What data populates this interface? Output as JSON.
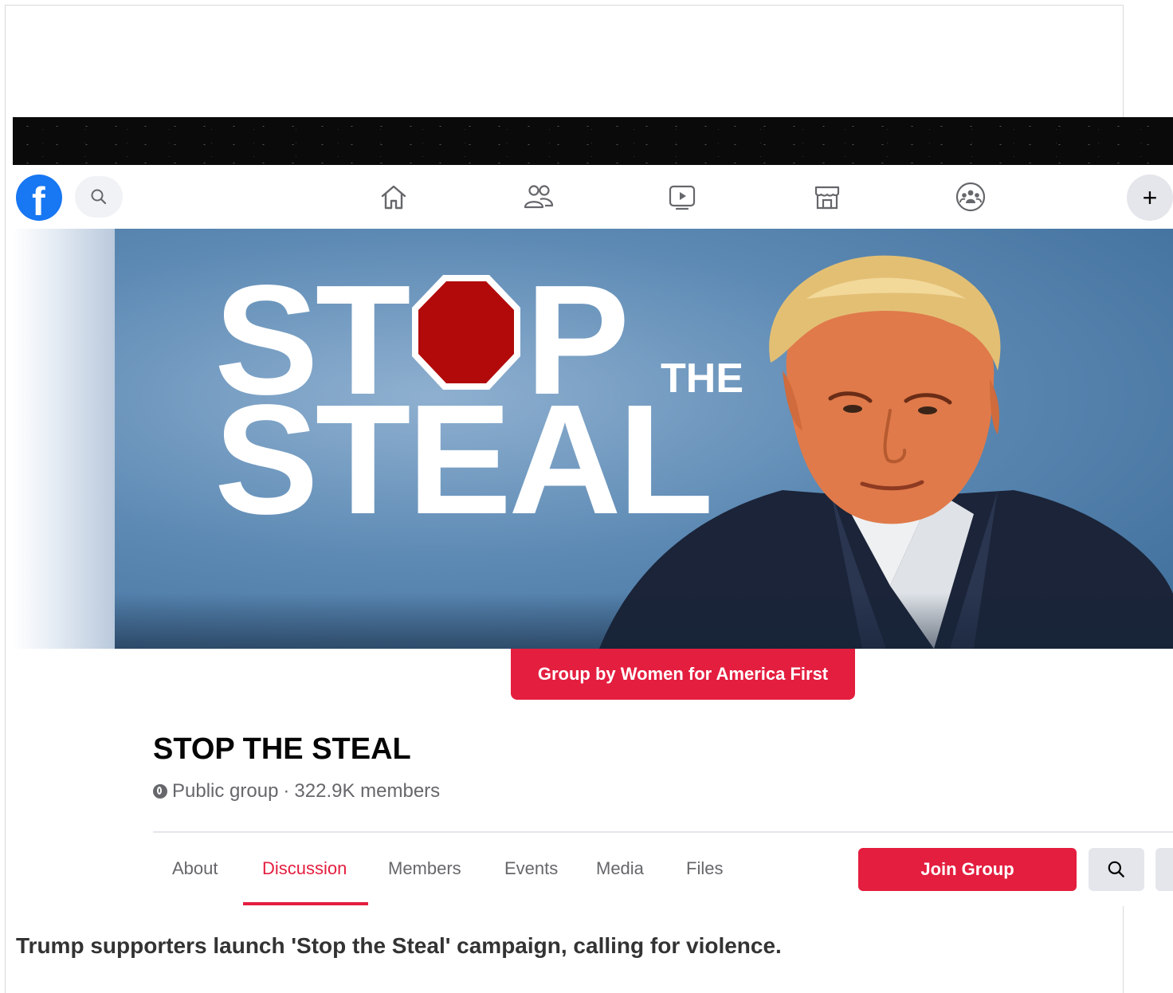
{
  "cover": {
    "line1_prefix": "ST",
    "line1_suffix": "P",
    "small_word": "THE",
    "line2": "STEAL"
  },
  "group": {
    "owner_label": "Group by Women for America First",
    "title": "STOP THE STEAL",
    "privacy": "Public group",
    "separator": "·",
    "members": "322.9K members"
  },
  "tabs": [
    {
      "label": "About",
      "active": false
    },
    {
      "label": "Discussion",
      "active": true
    },
    {
      "label": "Members",
      "active": false
    },
    {
      "label": "Events",
      "active": false
    },
    {
      "label": "Media",
      "active": false
    },
    {
      "label": "Files",
      "active": false
    }
  ],
  "actions": {
    "join_label": "Join Group",
    "plus_label": "+"
  },
  "nav": {
    "logo_letter": "f",
    "icons": [
      "home-icon",
      "friends-icon",
      "watch-icon",
      "marketplace-icon",
      "groups-icon"
    ]
  },
  "caption": "Trump supporters launch 'Stop the Steal' campaign, calling for violence.",
  "colors": {
    "brand_blue": "#1877f2",
    "accent_red": "#e41e3f",
    "stop_sign": "#b20a0a"
  }
}
